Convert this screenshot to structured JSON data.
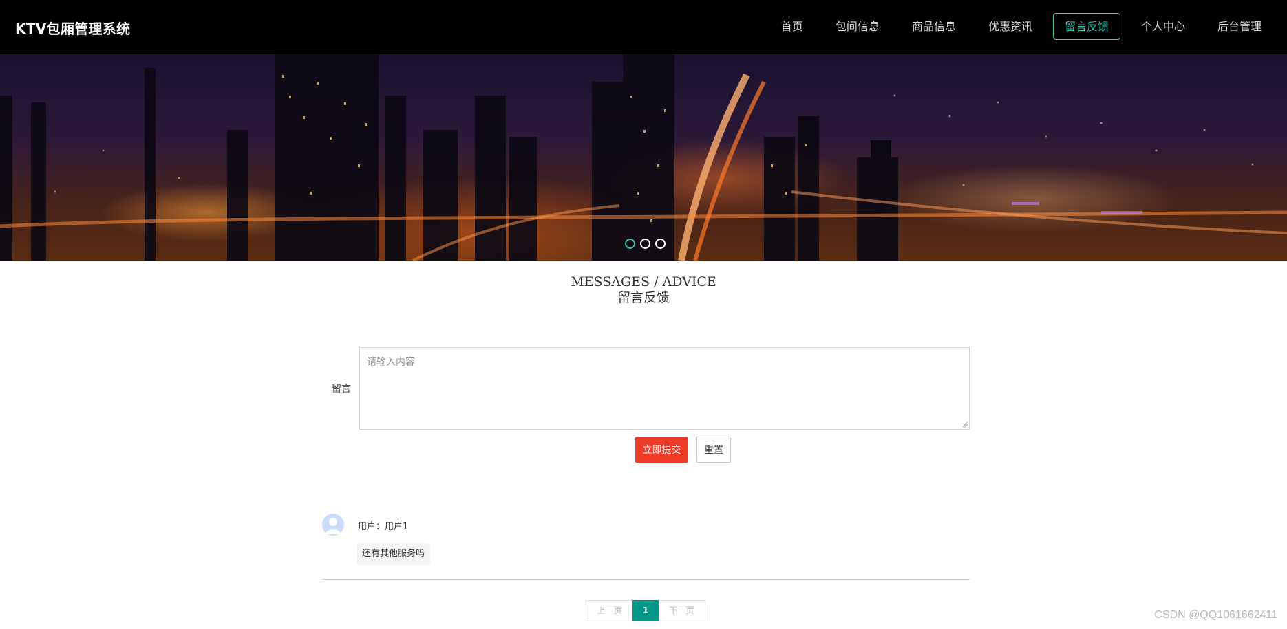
{
  "header": {
    "brand": "KTV包厢管理系统",
    "nav": [
      {
        "label": "首页",
        "active": false
      },
      {
        "label": "包间信息",
        "active": false
      },
      {
        "label": "商品信息",
        "active": false
      },
      {
        "label": "优惠资讯",
        "active": false
      },
      {
        "label": "留言反馈",
        "active": true
      },
      {
        "label": "个人中心",
        "active": false
      },
      {
        "label": "后台管理",
        "active": false
      }
    ]
  },
  "banner": {
    "image": "night-city-skyline",
    "slides": 3,
    "active_slide": 1
  },
  "section": {
    "title_en": "MESSAGES / ADVICE",
    "title_zh": "留言反馈"
  },
  "form": {
    "label": "留言",
    "placeholder": "请输入内容",
    "value": "",
    "submit_label": "立即提交",
    "reset_label": "重置"
  },
  "messages": [
    {
      "user": "用户：用户1",
      "content": "还有其他服务吗",
      "avatar_icon": "user-avatar-icon"
    }
  ],
  "pagination": {
    "prev_label": "上一页",
    "current": "1",
    "next_label": "下一页"
  },
  "watermark": "CSDN @QQ1061662411",
  "colors": {
    "accent": "#2ec4b0",
    "submit": "#ee3b28",
    "page_active": "#009688",
    "header_bg": "#000000"
  }
}
